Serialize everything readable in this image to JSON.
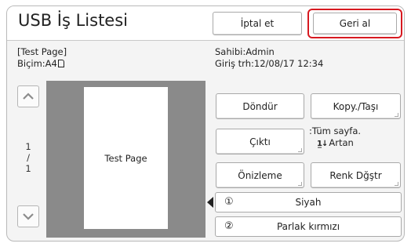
{
  "header": {
    "title": "USB İş Listesi",
    "cancel_label": "İptal et",
    "undo_label": "Geri al"
  },
  "job": {
    "name": "[Test Page]",
    "format": "Biçim:A4",
    "owner": "Sahibi:Admin",
    "entry_date": "Giriş trh:12/08/17  12:34"
  },
  "pager": {
    "current": "1",
    "separator": "/",
    "total": "1"
  },
  "preview": {
    "page_text": "Test Page"
  },
  "actions": {
    "rotate": "Döndür",
    "copy_move": "Kopy./Taşı",
    "output": "Çıktı",
    "preview": "Önizleme",
    "color_change": "Renk Dğştr"
  },
  "sort": {
    "line1": ":Tüm sayfa.",
    "line2": "Artan",
    "icon_glyph": "1̲↓",
    "icon": "ascending-sort-icon"
  },
  "drums": [
    {
      "number": "①",
      "color_name": "Siyah",
      "selected": true
    },
    {
      "number": "②",
      "color_name": "Parlak kırmızı",
      "selected": false
    }
  ],
  "colors": {
    "accent_red": "#d71920",
    "preview_bg": "#8a8a8a",
    "panel_bg": "#f4f4f4"
  }
}
